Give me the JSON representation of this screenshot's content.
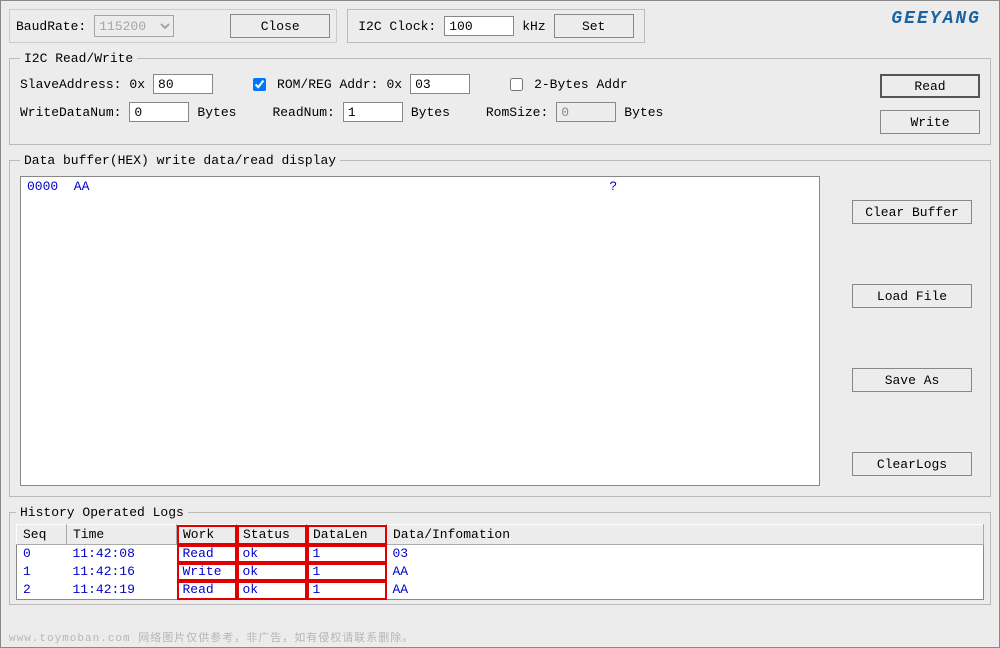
{
  "serial": {
    "baud_label": "BaudRate:",
    "baud_value": "115200",
    "close_label": "Close"
  },
  "i2c_clock": {
    "label": "I2C Clock:",
    "value": "100",
    "unit": "kHz",
    "set_label": "Set"
  },
  "brand": "GEEYANG",
  "rw": {
    "legend": "I2C Read/Write",
    "slave_label": "SlaveAddress:",
    "hex_prefix": "0x",
    "slave_value": "80",
    "rom_check_label": "ROM/REG Addr:",
    "rom_value": "03",
    "two_bytes_label": "2-Bytes Addr",
    "write_num_label": "WriteDataNum:",
    "write_num_value": "0",
    "bytes_label": "Bytes",
    "read_num_label": "ReadNum:",
    "read_num_value": "1",
    "rom_size_label": "RomSize:",
    "rom_size_value": "0",
    "read_btn": "Read",
    "write_btn": "Write"
  },
  "buffer": {
    "legend": "Data buffer(HEX) write data/read display",
    "content": "0000  AA",
    "qmark": "?",
    "clear_label": "Clear Buffer",
    "load_label": "Load File",
    "save_label": "Save As",
    "clearlogs_label": "ClearLogs"
  },
  "logs": {
    "legend": "History Operated Logs",
    "headers": {
      "seq": "Seq",
      "time": "Time",
      "work": "Work",
      "status": "Status",
      "datalen": "DataLen",
      "data": "Data/Infomation"
    },
    "rows": [
      {
        "seq": "0",
        "time": "11:42:08",
        "work": "Read",
        "status": "ok",
        "datalen": "1",
        "data": "03"
      },
      {
        "seq": "1",
        "time": "11:42:16",
        "work": "Write",
        "status": "ok",
        "datalen": "1",
        "data": "AA"
      },
      {
        "seq": "2",
        "time": "11:42:19",
        "work": "Read",
        "status": "ok",
        "datalen": "1",
        "data": "AA"
      }
    ]
  },
  "watermark": "www.toymoban.com 网络图片仅供参考，非广告，如有侵权请联系删除。"
}
